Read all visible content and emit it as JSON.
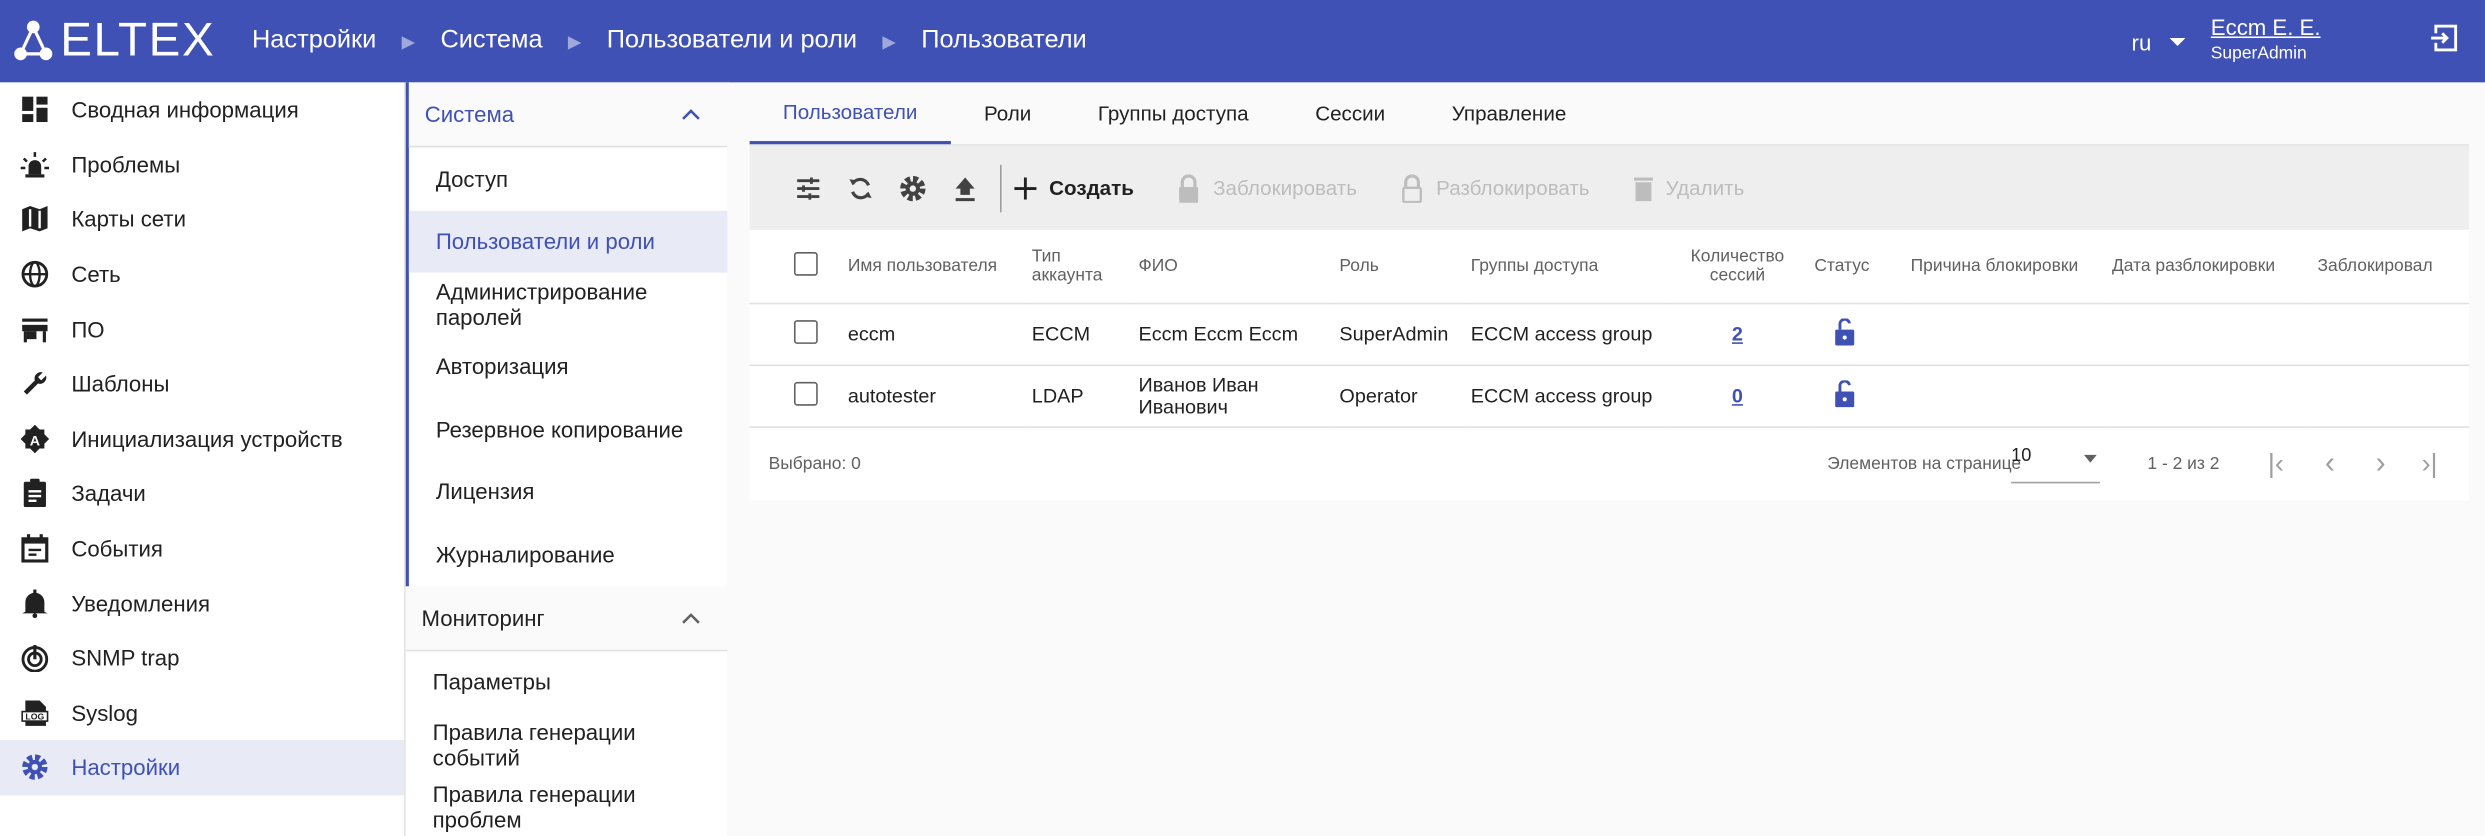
{
  "header": {
    "logo": "ELTEX",
    "breadcrumbs": [
      "Настройки",
      "Система",
      "Пользователи и роли",
      "Пользователи"
    ],
    "lang": "ru",
    "user": "Eccm E. E.",
    "role": "SuperAdmin",
    "accent": "#3f51b5"
  },
  "sidebar": {
    "items": [
      {
        "label": "Сводная информация",
        "icon": "dashboard"
      },
      {
        "label": "Проблемы",
        "icon": "alarm"
      },
      {
        "label": "Карты сети",
        "icon": "map"
      },
      {
        "label": "Сеть",
        "icon": "globe"
      },
      {
        "label": "ПО",
        "icon": "store"
      },
      {
        "label": "Шаблоны",
        "icon": "wrench"
      },
      {
        "label": "Инициализация устройств",
        "icon": "auto"
      },
      {
        "label": "Задачи",
        "icon": "clipboard"
      },
      {
        "label": "События",
        "icon": "calendar"
      },
      {
        "label": "Уведомления",
        "icon": "bell"
      },
      {
        "label": "SNMP trap",
        "icon": "trap"
      },
      {
        "label": "Syslog",
        "icon": "log"
      },
      {
        "label": "Настройки",
        "icon": "gear",
        "active": true
      }
    ]
  },
  "submenu": {
    "groups": [
      {
        "title": "Система",
        "items": [
          "Доступ",
          "Пользователи и роли",
          "Администрирование паролей",
          "Авторизация",
          "Резервное копирование",
          "Лицензия",
          "Журналирование"
        ],
        "active": 1
      },
      {
        "title": "Мониторинг",
        "items": [
          "Параметры",
          "Правила генерации событий",
          "Правила генерации проблем"
        ]
      }
    ]
  },
  "tabs": [
    "Пользователи",
    "Роли",
    "Группы доступа",
    "Сессии",
    "Управление"
  ],
  "toolbar": {
    "create": "Создать",
    "lock": "Заблокировать",
    "unlock": "Разблокировать",
    "delete": "Удалить"
  },
  "table": {
    "columns": [
      "Имя пользователя",
      "Тип аккаунта",
      "ФИО",
      "Роль",
      "Группы доступа",
      "Количество сессий",
      "Статус",
      "Причина блокировки",
      "Дата разблокировки",
      "Заблокировал"
    ],
    "rows": [
      {
        "username": "eccm",
        "type": "ECCM",
        "name": "Eccm Eccm Eccm",
        "role": "SuperAdmin",
        "groups": "ECCM access group",
        "sessions": "2"
      },
      {
        "username": "autotester",
        "type": "LDAP",
        "name": "Иванов Иван Иванович",
        "role": "Operator",
        "groups": "ECCM access group",
        "sessions": "0"
      }
    ]
  },
  "footer": {
    "selected": "Выбрано: 0",
    "per_page_label": "Элементов на странице",
    "per_page": "10",
    "range": "1 - 2 из 2"
  }
}
